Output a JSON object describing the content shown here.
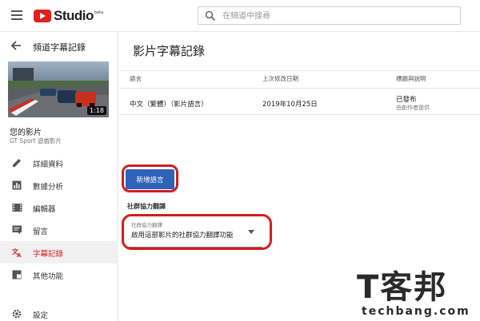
{
  "topbar": {
    "logo_text": "Studio",
    "logo_badge": "beta",
    "search_placeholder": "在頻道中搜尋"
  },
  "sidebar": {
    "back_label": "頻道字幕記錄",
    "thumbnail_duration": "1:18",
    "my_video_label": "您的影片",
    "video_name": "GT Sport 遊戲影片",
    "items": [
      {
        "label": "詳細資料",
        "icon": "pencil-icon"
      },
      {
        "label": "數據分析",
        "icon": "analytics-icon"
      },
      {
        "label": "編輯器",
        "icon": "film-icon"
      },
      {
        "label": "留言",
        "icon": "comment-icon"
      },
      {
        "label": "字幕記錄",
        "icon": "translate-icon",
        "active": true
      },
      {
        "label": "其他功能",
        "icon": "more-features-icon"
      }
    ],
    "settings_label": "設定"
  },
  "main": {
    "title": "影片字幕記錄",
    "table": {
      "headers": {
        "language": "語言",
        "modified": "上次修改日期",
        "title_desc": "標題與說明"
      },
      "rows": [
        {
          "language": "中文（繁體）（影片語言）",
          "modified": "2019年10月25日",
          "status": "已發布",
          "status_sub": "由創作者提供"
        }
      ]
    },
    "add_language_button": "新增語言",
    "community_heading": "社群協力翻譯",
    "dropdown": {
      "label": "社群協力翻譯",
      "value": "啟用這部影片的社群協力翻譯功能"
    }
  },
  "watermark": {
    "big": "T客邦",
    "small": "techbang.com"
  },
  "colors": {
    "accent_red": "#d21d1d",
    "button_blue": "#2f63b8",
    "active_text": "#d42727"
  }
}
